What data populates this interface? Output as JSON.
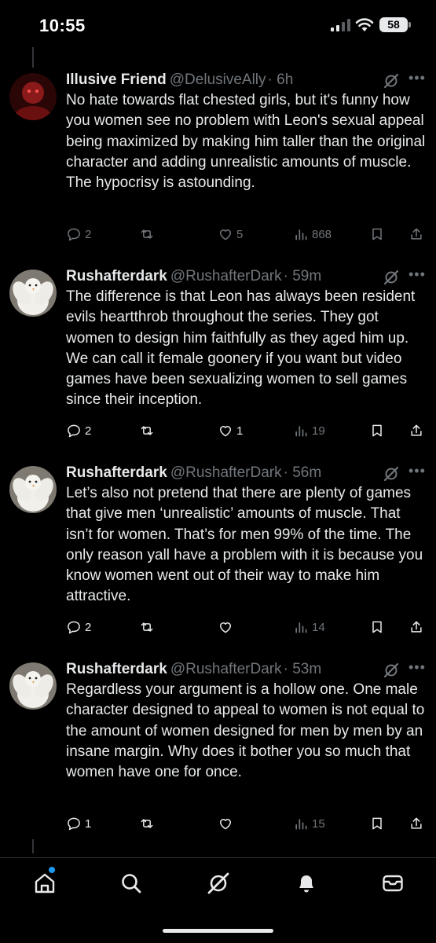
{
  "status_bar": {
    "time": "10:55",
    "battery": "58"
  },
  "posts": [
    {
      "name": "Illusive Friend",
      "handle": "@DelusiveAlly",
      "time": "· 6h",
      "text": "No hate towards flat chested girls, but it's funny how you women see no problem with Leon's sexual appeal being maximized by making him taller than the original character and adding unrealistic amounts of muscle. The hypocrisy is astounding.",
      "replies": "2",
      "reposts": "",
      "likes": "5",
      "views": "868"
    },
    {
      "name": "Rushafterdark",
      "handle": "@RushafterDark",
      "time": "· 59m",
      "text": "The difference is that Leon has always been resident evils heartthrob throughout the series. They got women to design him faithfully as they aged him up. We can call it female goonery if you want but video games have been sexualizing women to sell games since their inception.",
      "replies": "2",
      "reposts": "",
      "likes": "1",
      "views": "19"
    },
    {
      "name": "Rushafterdark",
      "handle": "@RushafterDark",
      "time": "· 56m",
      "text": "Let’s also not pretend that there are plenty of games that give men ‘unrealistic’ amounts of muscle. That isn’t for women. That’s for men 99% of the time. The only reason yall have a problem with it is because you know women went out of their way to make him attractive.",
      "replies": "2",
      "reposts": "",
      "likes": "",
      "views": "14"
    },
    {
      "name": "Rushafterdark",
      "handle": "@RushafterDark",
      "time": "· 53m",
      "text": "Regardless your argument is a hollow one. One male character designed to appeal to women is not equal to the amount of women designed for men by men by an insane margin. Why does it bother you so much that women have one for once.",
      "replies": "1",
      "reposts": "",
      "likes": "",
      "views": "15"
    }
  ],
  "icons": {
    "status": [
      "signal-icon",
      "wifi-icon",
      "battery-icon"
    ],
    "post": [
      "grok-icon",
      "more-icon",
      "reply-icon",
      "repost-icon",
      "like-icon",
      "views-icon",
      "bookmark-icon",
      "share-icon"
    ],
    "tab_bar": [
      "home-icon",
      "search-icon",
      "grok-icon",
      "notifications-icon",
      "messages-icon"
    ]
  },
  "colors": {
    "background": "#000000",
    "text": "#e7e9ea",
    "secondary": "#71767b",
    "accent": "#1d9bf0"
  }
}
